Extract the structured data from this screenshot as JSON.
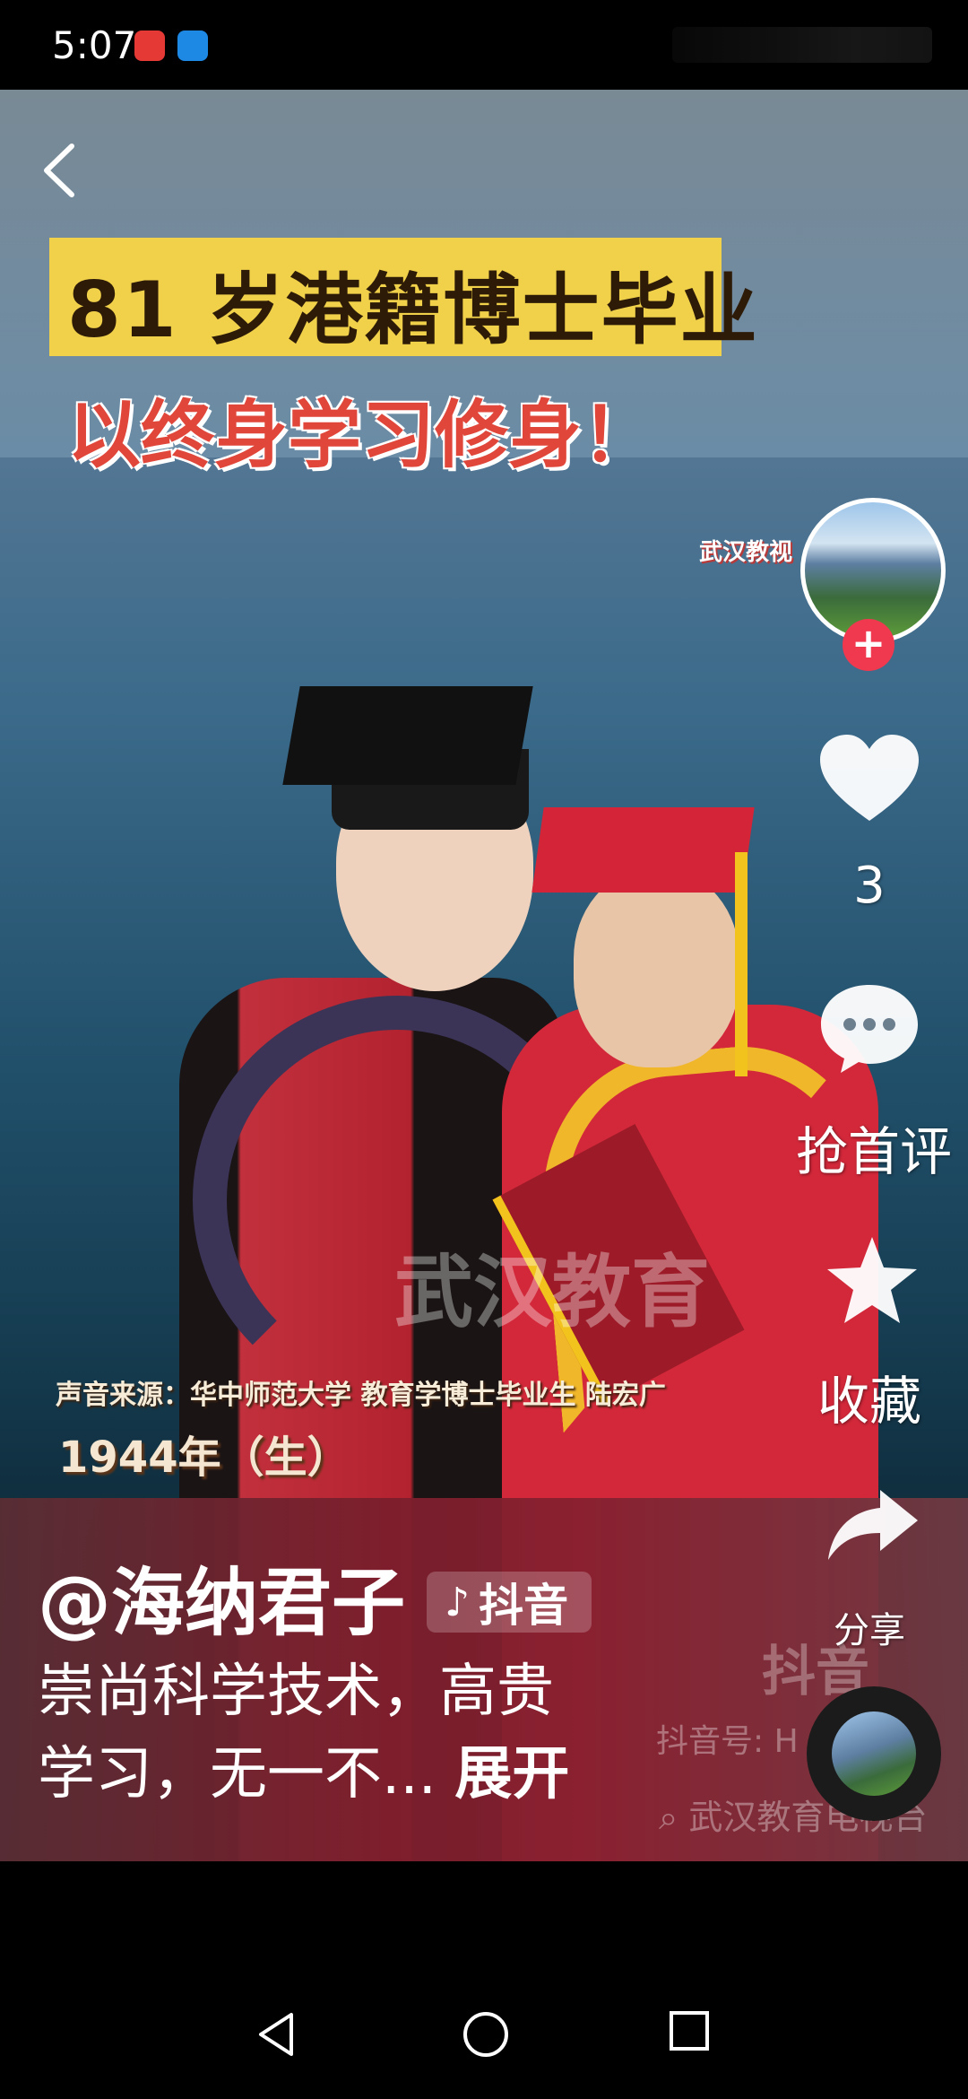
{
  "status_bar": {
    "time": "5:07",
    "app_icons": [
      "huawei-icon",
      "cloud-app-icon"
    ],
    "colors": {
      "huawei": "#e53935",
      "cloud": "#1e88e5"
    }
  },
  "video": {
    "title": "81 岁港籍博士毕业",
    "subtitle": "以终身学习修身！",
    "corner_logo": "武汉教视",
    "watermark": "武汉教育",
    "source_caption": "声音来源：华中师范大学 教育学博士毕业生 陆宏广",
    "year_caption": "1944年（生）",
    "tiktok_watermark": "抖音",
    "tiktok_id": "抖音号: H",
    "tiktok_search": "武汉教育电视台"
  },
  "actions": {
    "likes": "3",
    "comment_label": "抢首评",
    "favorite_label": "收藏",
    "share_label": "分享"
  },
  "post": {
    "author": "@海纳君子",
    "platform_tag": "抖音",
    "description": "崇尚科学技术，高贵学习，无一不...",
    "description_line1": "崇尚科学技术，高贵",
    "description_line2": "学习，无一不...",
    "expand_label": "展开"
  },
  "colors": {
    "accent": "#f0384f",
    "title_bg": "#f1d14a",
    "subtitle": "#e1463a"
  }
}
